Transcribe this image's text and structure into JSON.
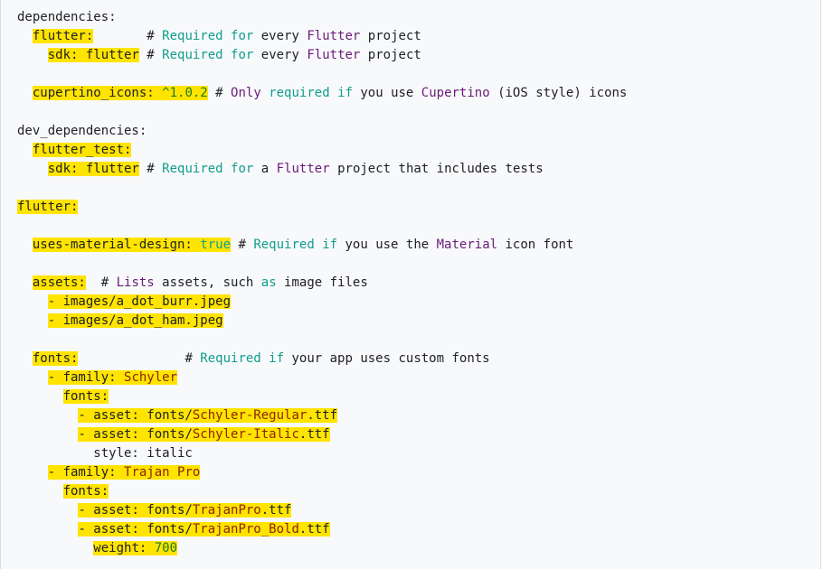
{
  "lines": [
    [
      {
        "t": "dependencies:",
        "c": ""
      }
    ],
    [
      {
        "t": "  ",
        "c": ""
      },
      {
        "t": "flutter:",
        "c": "hl"
      },
      {
        "t": "       # ",
        "c": ""
      },
      {
        "t": "Required",
        "c": "cm"
      },
      {
        "t": " ",
        "c": ""
      },
      {
        "t": "for",
        "c": "cm"
      },
      {
        "t": " every ",
        "c": ""
      },
      {
        "t": "Flutter",
        "c": "ty"
      },
      {
        "t": " project",
        "c": ""
      }
    ],
    [
      {
        "t": "    ",
        "c": ""
      },
      {
        "t": "sdk: flutter",
        "c": "hl"
      },
      {
        "t": " # ",
        "c": ""
      },
      {
        "t": "Required",
        "c": "cm"
      },
      {
        "t": " ",
        "c": ""
      },
      {
        "t": "for",
        "c": "cm"
      },
      {
        "t": " every ",
        "c": ""
      },
      {
        "t": "Flutter",
        "c": "ty"
      },
      {
        "t": " project",
        "c": ""
      }
    ],
    [],
    [
      {
        "t": "  ",
        "c": ""
      },
      {
        "t": "cupertino_icons: ",
        "c": "hl"
      },
      {
        "t": "^1.0.2",
        "c": "hl nu"
      },
      {
        "t": " # ",
        "c": ""
      },
      {
        "t": "Only",
        "c": "ty"
      },
      {
        "t": " ",
        "c": ""
      },
      {
        "t": "required",
        "c": "cm"
      },
      {
        "t": " ",
        "c": ""
      },
      {
        "t": "if",
        "c": "cm"
      },
      {
        "t": " you use ",
        "c": ""
      },
      {
        "t": "Cupertino",
        "c": "ty"
      },
      {
        "t": " (iOS style) icons",
        "c": ""
      }
    ],
    [],
    [
      {
        "t": "dev_dependencies:",
        "c": ""
      }
    ],
    [
      {
        "t": "  ",
        "c": ""
      },
      {
        "t": "flutter_test:",
        "c": "hl"
      }
    ],
    [
      {
        "t": "    ",
        "c": ""
      },
      {
        "t": "sdk: flutter",
        "c": "hl"
      },
      {
        "t": " # ",
        "c": ""
      },
      {
        "t": "Required",
        "c": "cm"
      },
      {
        "t": " ",
        "c": ""
      },
      {
        "t": "for",
        "c": "cm"
      },
      {
        "t": " a ",
        "c": ""
      },
      {
        "t": "Flutter",
        "c": "ty"
      },
      {
        "t": " project that includes tests",
        "c": ""
      }
    ],
    [],
    [
      {
        "t": "flutter:",
        "c": "hl"
      }
    ],
    [],
    [
      {
        "t": "  ",
        "c": ""
      },
      {
        "t": "uses-material-design: ",
        "c": "hl"
      },
      {
        "t": "true",
        "c": "hl cm"
      },
      {
        "t": " # ",
        "c": ""
      },
      {
        "t": "Required",
        "c": "cm"
      },
      {
        "t": " ",
        "c": ""
      },
      {
        "t": "if",
        "c": "cm"
      },
      {
        "t": " you use the ",
        "c": ""
      },
      {
        "t": "Material",
        "c": "ty"
      },
      {
        "t": " icon font",
        "c": ""
      }
    ],
    [],
    [
      {
        "t": "  ",
        "c": ""
      },
      {
        "t": "assets:",
        "c": "hl"
      },
      {
        "t": "  # ",
        "c": ""
      },
      {
        "t": "Lists",
        "c": "ty"
      },
      {
        "t": " assets, such ",
        "c": ""
      },
      {
        "t": "as",
        "c": "cm"
      },
      {
        "t": " image files",
        "c": ""
      }
    ],
    [
      {
        "t": "    ",
        "c": ""
      },
      {
        "t": "- images/a_dot_burr.jpeg",
        "c": "hl"
      }
    ],
    [
      {
        "t": "    ",
        "c": ""
      },
      {
        "t": "- images/a_dot_ham.jpeg",
        "c": "hl"
      }
    ],
    [],
    [
      {
        "t": "  ",
        "c": ""
      },
      {
        "t": "fonts:",
        "c": "hl"
      },
      {
        "t": "              # ",
        "c": ""
      },
      {
        "t": "Required",
        "c": "cm"
      },
      {
        "t": " ",
        "c": ""
      },
      {
        "t": "if",
        "c": "cm"
      },
      {
        "t": " your app uses custom fonts",
        "c": ""
      }
    ],
    [
      {
        "t": "    ",
        "c": ""
      },
      {
        "t": "- family: ",
        "c": "hl"
      },
      {
        "t": "Schyler",
        "c": "hl st"
      }
    ],
    [
      {
        "t": "      ",
        "c": ""
      },
      {
        "t": "fonts:",
        "c": "hl"
      }
    ],
    [
      {
        "t": "        ",
        "c": ""
      },
      {
        "t": "- asset: fonts/",
        "c": "hl"
      },
      {
        "t": "Schyler-Regular",
        "c": "hl st"
      },
      {
        "t": ".ttf",
        "c": "hl"
      }
    ],
    [
      {
        "t": "        ",
        "c": ""
      },
      {
        "t": "- asset: fonts/",
        "c": "hl"
      },
      {
        "t": "Schyler-Italic",
        "c": "hl st"
      },
      {
        "t": ".ttf",
        "c": "hl"
      }
    ],
    [
      {
        "t": "          style: italic",
        "c": ""
      }
    ],
    [
      {
        "t": "    ",
        "c": ""
      },
      {
        "t": "- family: ",
        "c": "hl"
      },
      {
        "t": "Trajan Pro",
        "c": "hl st"
      }
    ],
    [
      {
        "t": "      ",
        "c": ""
      },
      {
        "t": "fonts:",
        "c": "hl"
      }
    ],
    [
      {
        "t": "        ",
        "c": ""
      },
      {
        "t": "- asset: fonts/",
        "c": "hl"
      },
      {
        "t": "TrajanPro",
        "c": "hl st"
      },
      {
        "t": ".ttf",
        "c": "hl"
      }
    ],
    [
      {
        "t": "        ",
        "c": ""
      },
      {
        "t": "- asset: fonts/",
        "c": "hl"
      },
      {
        "t": "TrajanPro_Bold",
        "c": "hl st"
      },
      {
        "t": ".ttf",
        "c": "hl"
      }
    ],
    [
      {
        "t": "          ",
        "c": ""
      },
      {
        "t": "weight: ",
        "c": "hl"
      },
      {
        "t": "700",
        "c": "hl nu"
      }
    ]
  ]
}
